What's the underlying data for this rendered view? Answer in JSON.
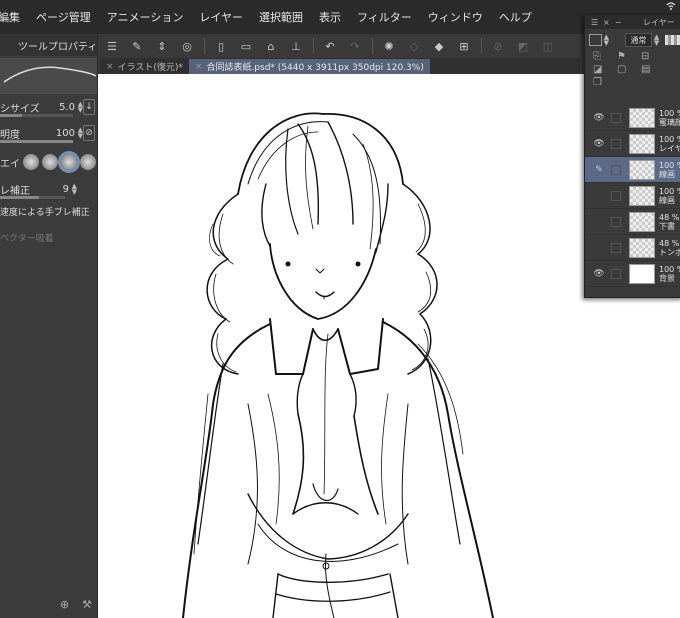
{
  "menu": {
    "items": [
      "編集",
      "ページ管理",
      "アニメーション",
      "レイヤー",
      "選択範囲",
      "表示",
      "フィルター",
      "ウィンドウ",
      "ヘルプ"
    ]
  },
  "document_tabs": [
    {
      "label": "イラスト(復元)*",
      "active": false
    },
    {
      "label": "合同誌表紙.psd* (5440 x 3911px 350dpi 120.3%)",
      "active": true
    }
  ],
  "tool_property": {
    "tab_label": "ツールプロパティ",
    "brush_size_label": "シサイズ",
    "brush_size_value": "5.0",
    "opacity_label": "明度",
    "opacity_value": "100",
    "shape_label": "エイ",
    "stabilization_label": "レ補正",
    "stabilization_value": "9",
    "speed_stabilization_label": "速度による手ブレ補正",
    "vector_label": "ベクター吸着"
  },
  "layer_panel": {
    "title": "レイヤー",
    "blend_mode": "通常",
    "layers": [
      {
        "percent": "100 %",
        "name": "蜜璃顔",
        "visible": true,
        "selected": false,
        "thumb": "checker"
      },
      {
        "percent": "100 %",
        "name": "レイヤ",
        "visible": true,
        "selected": false,
        "thumb": "checker"
      },
      {
        "percent": "100 %",
        "name": "線画",
        "visible": false,
        "selected": true,
        "thumb": "checker"
      },
      {
        "percent": "100 %",
        "name": "線画",
        "visible": false,
        "selected": false,
        "thumb": "checker"
      },
      {
        "percent": "48 %",
        "name": "下書",
        "visible": false,
        "selected": false,
        "thumb": "checker"
      },
      {
        "percent": "48 %",
        "name": "トンボ",
        "visible": false,
        "selected": false,
        "thumb": "checker"
      },
      {
        "percent": "100 %",
        "name": "背景",
        "visible": true,
        "selected": false,
        "thumb": "white"
      }
    ]
  },
  "colors": {
    "accent": "#56637a",
    "selected_layer": "#5a6a88",
    "canvas": "#ffffff"
  }
}
